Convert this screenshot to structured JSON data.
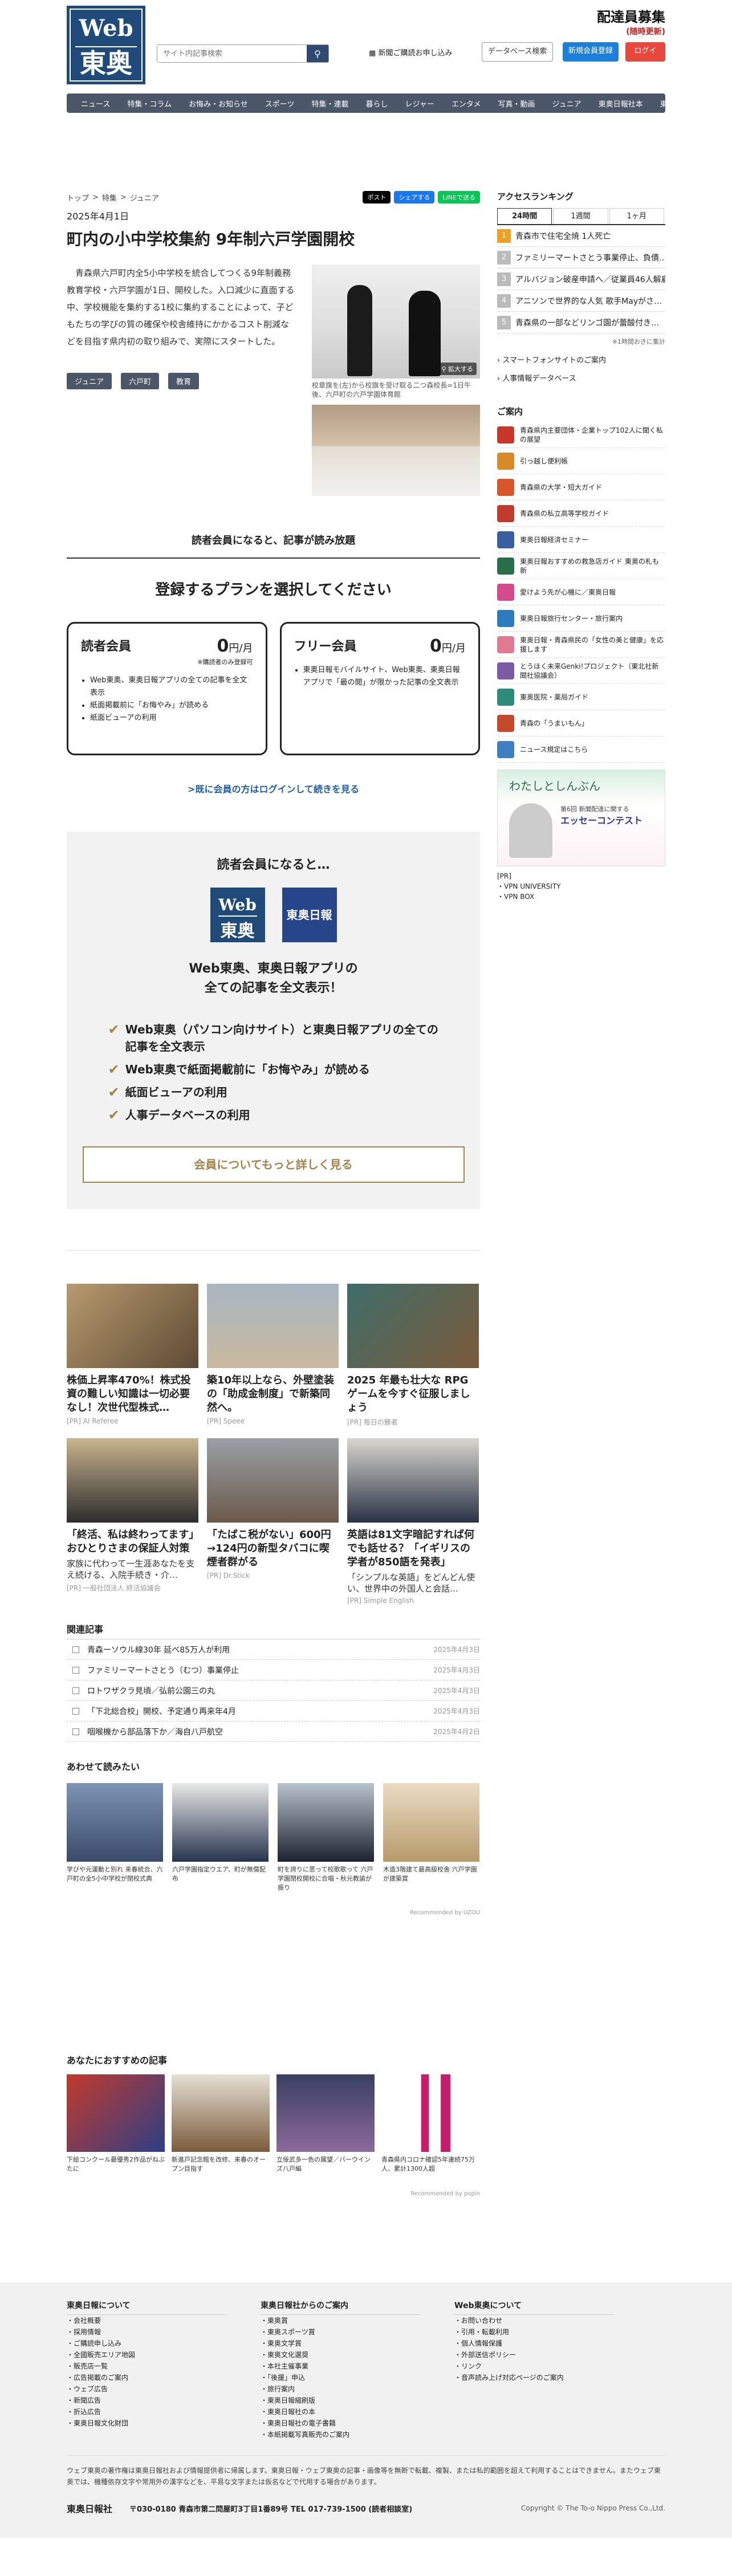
{
  "header": {
    "logo_line1": "Web",
    "logo_line2": "東奥",
    "search_placeholder": "サイト内記事検索",
    "notice_link": "新聞ご購読お申し込み",
    "database_button": "データベース検索",
    "register_button": "新規会員登録",
    "login_button": "ログイン",
    "recruit_title": "配達員募集",
    "recruit_sub": "(随時更新)"
  },
  "nav": [
    "ニュース",
    "特集・コラム",
    "お悔み・お知らせ",
    "スポーツ",
    "特集・連載",
    "暮らし",
    "レジャー",
    "エンタメ",
    "写真・動画",
    "ジュニア",
    "東奥日報社本",
    "東奥広場"
  ],
  "article": {
    "crumbs": [
      "トップ",
      "特集",
      "ジュニア"
    ],
    "share": [
      "ポスト",
      "シェアする",
      "LINEで送る"
    ],
    "date": "2025年4月1日",
    "title": "町内の小中学校集約 9年制六戸学園開校",
    "body": "青森県六戸町内全5小中学校を統合してつくる9年制義務教育学校・六戸学園が1日、開校した。入口減少に直面する中、学校機能を集約する1校に集約することによって、子どもたちの学びの質の確保や校舎維持にかかるコスト削減などを目指す県内初の取り組みで、実際にスタートした。",
    "tags": [
      "ジュニア",
      "六戸町",
      "教育"
    ],
    "photo_zoom": "拡大する",
    "photo_caption": "校章旗を(左)から校旗を受け取る二つ森校長=1日午後、六戸町の六戸学園体育館"
  },
  "paywall": {
    "lead": "読者会員になると、記事が読み放題",
    "plan_heading": "登録するプランを選択してください",
    "plans": [
      {
        "name": "読者会員",
        "price": "0",
        "unit": "円/月",
        "note": "※購読者のみ登録可",
        "features": [
          "Web東奥、東奥日報アプリの全ての記事を全文表示",
          "紙面掲載前に「お悔やみ」が読める",
          "紙面ビューアの利用"
        ]
      },
      {
        "name": "フリー会員",
        "price": "0",
        "unit": "円/月",
        "note": "",
        "features": [
          "東奥日報モバイルサイト、Web東奥、東奥日報アプリで「最の閲」が限かった記事の全文表示"
        ]
      }
    ],
    "login_link": ">既に会員の方はログインして続きを見る"
  },
  "promo": {
    "heading": "読者会員になると…",
    "logo_a1": "Web",
    "logo_a2": "東奥",
    "logo_b": "東奥日報",
    "tagline1": "Web東奥、東奥日報アプリの",
    "tagline2": "全ての記事を全文表示！",
    "benefits": [
      "Web東奥（パソコン向けサイト）と東奥日報アプリの全ての記事を全文表示",
      "Web東奥で紙面掲載前に「お悔やみ」が読める",
      "紙面ビューアの利用",
      "人事データベースの利用"
    ],
    "more_button": "会員についてもっと詳しく見る"
  },
  "cards": [
    {
      "title": "株価上昇率470%！株式投資の難しい知識は一切必要なし！次世代型株式…",
      "snippet": "",
      "pr": "[PR] AI Referee"
    },
    {
      "title": "築10年以上なら、外壁塗装の「助成金制度」で新築同然へ。",
      "snippet": "",
      "pr": "[PR] Speee"
    },
    {
      "title": "2025 年最も壮大な RPG ゲームを今すぐ征服しましょう",
      "snippet": "",
      "pr": "[PR] 毎日の勝者"
    },
    {
      "title": "「終活、私は終わってます」おひとりさまの保証人対策",
      "snippet": "家族に代わって一生涯あなたを支え続ける、入院手続き・介…",
      "pr": "[PR] 一般社団法人 終活協議会"
    },
    {
      "title": "「たばこ税がない」600円→124円の新型タバコに喫煙者群がる",
      "snippet": "",
      "pr": "[PR] Dr.Stick"
    },
    {
      "title": "英語は81文字暗記すれば何でも話せる？「イギリスの学者が850語を発表」",
      "snippet": "「シンプルな英語」をどんどん使い、世界中の外国人と会話…",
      "pr": "[PR] Simple English"
    }
  ],
  "related": {
    "heading": "関連記事",
    "items": [
      {
        "title": "青森ーソウル線30年 延べ85万人が利用",
        "date": "2025年4月3日"
      },
      {
        "title": "ファミリーマートさとう（むつ）事業停止",
        "date": "2025年4月3日"
      },
      {
        "title": "ロトワザクラ見頃／弘前公園三の丸",
        "date": "2025年4月3日"
      },
      {
        "title": "「下北総合校」開校、予定通り再来年4月",
        "date": "2025年4月3日"
      },
      {
        "title": "咽喉機から部品落下か／海自八戸航空",
        "date": "2025年4月2日"
      }
    ]
  },
  "also_read": {
    "heading": "あわせて読みたい",
    "items": [
      "学びや元運動と別れ 来春統合、六戸町の全5小中学校が閉校式典",
      "六戸学園指定ウエア、町が無償配布",
      "町を誇りに思って校歌歌って 六戸学園閉校開校に合唱・秋元教諭が振り",
      "木造3階建て最高級校舎 六戸学園が建築賞"
    ],
    "credit": "Recommended by UZOU"
  },
  "recommended": {
    "heading": "あなたにおすすめの記事",
    "items": [
      "下絵コンクール最優秀2作品がねぶたに",
      "新進戸記念館を改修、来春のオープン目指す",
      "立佞武多一色の展望／バーウインズ八戸編",
      "青森県内コロナ確認5年連続75万人、累計1300人超"
    ],
    "credit": "Recommended by popin"
  },
  "sidebar": {
    "ranking_heading": "アクセスランキング",
    "ranking_tabs": [
      "24時間",
      "1週間",
      "1ヶ月"
    ],
    "ranking": [
      "青森市で住宅全焼 1人死亡",
      "ファミリーマートさとう事業停止、負債…",
      "アルバジョン破産申請へ／従業員46人解雇",
      "アニソンで世界的な人気 歌手Mayがさ…",
      "青森県の一部などリンゴ園が蕾酸付き…"
    ],
    "ranking_update": "※1時間おきに集計",
    "links": [
      "スマートフォンサイトのご案内",
      "人事情報データベース"
    ],
    "guide_heading": "ご案内",
    "guide": [
      "青森県内主要団体・企業トップ102人に聞く私の展望",
      "引っ越し便利帳",
      "青森県の大学・短大ガイド",
      "青森県の私立高等学校ガイド",
      "東奥日報経済セミナー",
      "東奥日報おすすめの救急店ガイド 東奥の札も新",
      "愛けよう先が心機に／東奥日報",
      "東奥日報旅行センター・旅行案内",
      "東奥日報・青森県民の「女性の美と健康」を応援します",
      "とうほく未来Genki!プロジェクト（東北社新聞社協議会）",
      "東奥医院・薬局ガイド",
      "青森の「うまいもん」",
      "ニュース規定はこちら"
    ],
    "guide_colors": [
      "#c9372c",
      "#d88a2b",
      "#d9562b",
      "#c13a2e",
      "#3a5e9e",
      "#2b6f4a",
      "#d44b8c",
      "#2d7bbd",
      "#e07a93",
      "#7c5ba6",
      "#2e8b7a",
      "#c14b2b",
      "#3f7fc1"
    ],
    "banner_title": "わたしとしんぶん",
    "banner_sub": "第6回 新聞配達に関する",
    "banner_main": "エッセーコンテスト",
    "pr_label": "[PR]",
    "pr_items": [
      "VPN UNIVERSITY",
      "VPN BOX"
    ]
  },
  "footer": {
    "col1_heading": "東奥日報について",
    "col1": [
      "会社概要",
      "採用情報",
      "ご購読申し込み",
      "全國販売エリア地図",
      "販売店一覧",
      "広告掲載のご案内",
      "ウェブ広告",
      "新聞広告",
      "折込広告",
      "東奥日報文化財団"
    ],
    "col2_heading": "東奥日報社からのご案内",
    "col2": [
      "東奥賞",
      "東奥スポーツ賞",
      "東奥文学賞",
      "東奥文化選奨",
      "本社主催事業",
      "「後援」申込",
      "旅行案内",
      "東奥日報縮刷版",
      "東奥日報社の本",
      "東奥日報社の電子書籍",
      "本紙掲載写真販売のご案内"
    ],
    "col3_heading": "Web東奥について",
    "col3": [
      "お問い合わせ",
      "引用・転載利用",
      "個人情報保護",
      "外部送信ポリシー",
      "リンク",
      "音声読み上げ対応ページのご案内"
    ],
    "notice": "ウェブ東奥の著作権は東奥日報社および情報提供者に帰属します。東奥日報・ウェブ東奥の記事・画像等を無断で転載、複製、または私的範囲を超えて利用することはできません。またウェブ東奥では、機種依存文字や常用外の漢字などを、平易な文字または仮名などで代用する場合があります。",
    "company": "東奥日報社",
    "address": "〒030-0180 青森市第二問屋町3丁目1番89号 TEL 017-739-1500 (読者相談室)",
    "copyright": "Copyright © The To-o Nippo Press Co.,Ltd."
  }
}
